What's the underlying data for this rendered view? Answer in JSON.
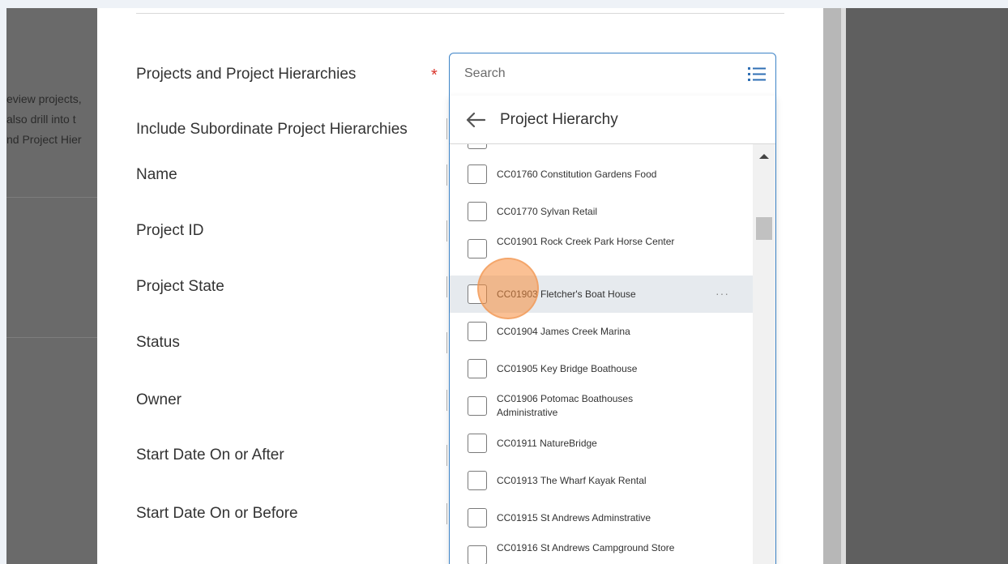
{
  "background": {
    "page_text": [
      "eview projects,",
      "also drill into t",
      "nd Project Hier"
    ]
  },
  "form": {
    "fields": [
      {
        "label": "Projects and Project Hierarchies"
      },
      {
        "label": "Include Subordinate Project Hierarchies"
      },
      {
        "label": "Name"
      },
      {
        "label": "Project ID"
      },
      {
        "label": "Project State"
      },
      {
        "label": "Status"
      },
      {
        "label": "Owner"
      },
      {
        "label": "Start Date On or After"
      },
      {
        "label": "Start Date On or Before"
      }
    ],
    "required_mark": "*"
  },
  "search": {
    "placeholder": "Search",
    "icon": "list-icon"
  },
  "dropdown": {
    "back_icon": "arrow-left-icon",
    "title": "Project Hierarchy",
    "items": [
      {
        "label": "CC01760 Constitution Gardens Food"
      },
      {
        "label": "CC01770 Sylvan Retail"
      },
      {
        "label": "CC01901 Rock Creek Park Horse Center"
      },
      {
        "label": "CC01903 Fletcher's Boat House",
        "more": "···"
      },
      {
        "label": "CC01904 James Creek Marina"
      },
      {
        "label": "CC01905 Key Bridge Boathouse"
      },
      {
        "label": "CC01906 Potomac Boathouses Administrative"
      },
      {
        "label": "CC01911 NatureBridge"
      },
      {
        "label": "CC01913 The Wharf Kayak Rental"
      },
      {
        "label": "CC01915 St Andrews Adminstrative"
      },
      {
        "label": "CC01916 St Andrews Campground Store"
      }
    ]
  },
  "colors": {
    "accent": "#3c83c7",
    "required": "#d9342b",
    "hover_row": "#e6eaee",
    "cursor": "#f58c3c"
  }
}
